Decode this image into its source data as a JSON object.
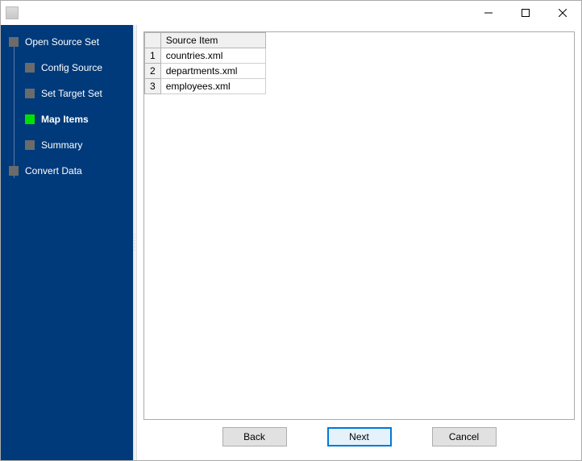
{
  "window": {
    "title": ""
  },
  "sidebar": {
    "items": [
      {
        "label": "Open Source Set",
        "level": 0,
        "current": false
      },
      {
        "label": "Config Source",
        "level": 1,
        "current": false
      },
      {
        "label": "Set Target Set",
        "level": 1,
        "current": false
      },
      {
        "label": "Map Items",
        "level": 1,
        "current": true
      },
      {
        "label": "Summary",
        "level": 1,
        "current": false
      },
      {
        "label": "Convert Data",
        "level": 0,
        "current": false
      }
    ]
  },
  "table": {
    "header": "Source Item",
    "rows": [
      {
        "n": "1",
        "item": "countries.xml"
      },
      {
        "n": "2",
        "item": "departments.xml"
      },
      {
        "n": "3",
        "item": "employees.xml"
      }
    ]
  },
  "buttons": {
    "back": "Back",
    "next": "Next",
    "cancel": "Cancel"
  }
}
